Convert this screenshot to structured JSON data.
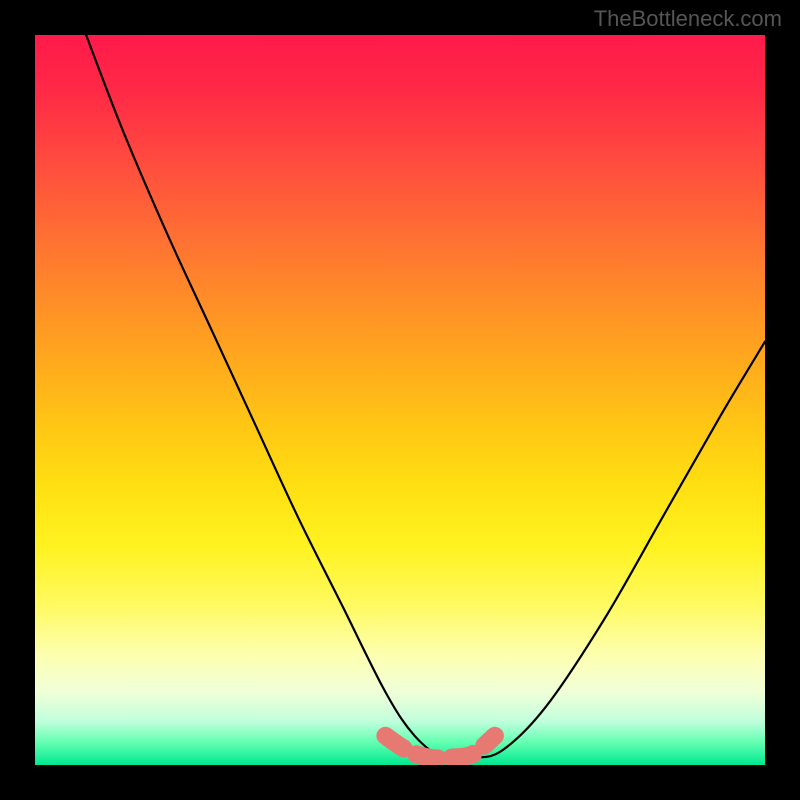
{
  "watermark": "TheBottleneck.com",
  "chart_data": {
    "type": "line",
    "title": "",
    "xlabel": "",
    "ylabel": "",
    "xlim": [
      0,
      100
    ],
    "ylim": [
      0,
      100
    ],
    "series": [
      {
        "name": "bottleneck-curve",
        "x": [
          7,
          12,
          18,
          24,
          30,
          36,
          42,
          48,
          52,
          56,
          60,
          64,
          70,
          78,
          86,
          94,
          100
        ],
        "values": [
          100,
          87,
          73,
          60,
          47,
          34,
          22,
          10,
          4,
          1,
          1,
          2,
          8,
          20,
          34,
          48,
          58
        ]
      }
    ],
    "highlight_segment": {
      "name": "optimal-range",
      "x": [
        48,
        51,
        54,
        57,
        60,
        63
      ],
      "values": [
        4,
        2,
        1,
        1,
        1.5,
        4
      ],
      "color": "#e67a73"
    },
    "gradient_stops": [
      {
        "pos": 0,
        "color": "#ff1a4a"
      },
      {
        "pos": 50,
        "color": "#ffd011"
      },
      {
        "pos": 85,
        "color": "#fdffb0"
      },
      {
        "pos": 100,
        "color": "#00e890"
      }
    ]
  }
}
